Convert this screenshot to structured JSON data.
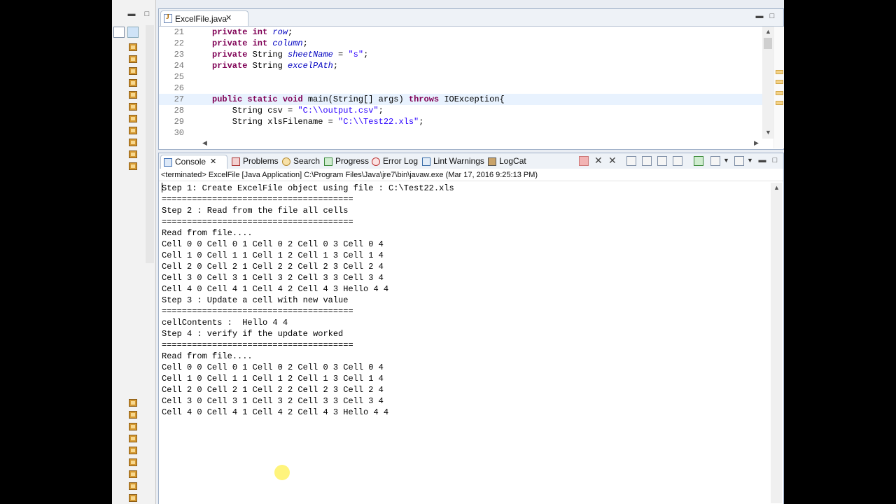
{
  "editor": {
    "tab_label": "ExcelFile.java",
    "lines": [
      {
        "num": "21",
        "parts": [
          [
            "kw",
            "private "
          ],
          [
            "kw",
            "int "
          ],
          [
            "fld",
            "row"
          ],
          [
            "var",
            ";"
          ]
        ]
      },
      {
        "num": "22",
        "parts": [
          [
            "kw",
            "private "
          ],
          [
            "kw",
            "int "
          ],
          [
            "fld",
            "column"
          ],
          [
            "var",
            ";"
          ]
        ]
      },
      {
        "num": "23",
        "parts": [
          [
            "kw",
            "private "
          ],
          [
            "var",
            "String "
          ],
          [
            "fld",
            "sheetName"
          ],
          [
            "var",
            " = "
          ],
          [
            "str",
            "\"s\""
          ],
          [
            "var",
            ";"
          ]
        ]
      },
      {
        "num": "24",
        "parts": [
          [
            "kw",
            "private "
          ],
          [
            "var",
            "String "
          ],
          [
            "fld",
            "excelPAth"
          ],
          [
            "var",
            ";"
          ]
        ]
      },
      {
        "num": "25",
        "parts": []
      },
      {
        "num": "26",
        "parts": []
      },
      {
        "num": "27",
        "parts": [
          [
            "kw",
            "public "
          ],
          [
            "kw",
            "static "
          ],
          [
            "kw",
            "void "
          ],
          [
            "var",
            "main(String[] args) "
          ],
          [
            "kw",
            "throws "
          ],
          [
            "var",
            "IOException{"
          ]
        ]
      },
      {
        "num": "28",
        "parts": [
          [
            "var",
            "    String csv = "
          ],
          [
            "str",
            "\"C:\\\\output.csv\""
          ],
          [
            "var",
            ";"
          ]
        ]
      },
      {
        "num": "29",
        "parts": [
          [
            "var",
            "    String xlsFilename = "
          ],
          [
            "str",
            "\"C:\\\\Test22.xls\""
          ],
          [
            "var",
            ";"
          ]
        ]
      },
      {
        "num": "30",
        "parts": []
      }
    ]
  },
  "console": {
    "tabs": [
      "Console",
      "Problems",
      "Search",
      "Progress",
      "Error Log",
      "Lint Warnings",
      "LogCat"
    ],
    "status": "<terminated> ExcelFile [Java Application] C:\\Program Files\\Java\\jre7\\bin\\javaw.exe (Mar 17, 2016 9:25:13 PM)",
    "output": [
      "Step 1: Create ExcelFile object using file : C:\\Test22.xls",
      "======================================",
      "Step 2 : Read from the file all cells",
      "======================================",
      "Read from file....",
      "Cell 0 0 Cell 0 1 Cell 0 2 Cell 0 3 Cell 0 4",
      "Cell 1 0 Cell 1 1 Cell 1 2 Cell 1 3 Cell 1 4",
      "Cell 2 0 Cell 2 1 Cell 2 2 Cell 2 3 Cell 2 4",
      "Cell 3 0 Cell 3 1 Cell 3 2 Cell 3 3 Cell 3 4",
      "Cell 4 0 Cell 4 1 Cell 4 2 Cell 4 3 Hello 4 4",
      "Step 3 : Update a cell with new value",
      "======================================",
      "cellContents :  Hello 4 4",
      "Step 4 : verify if the update worked",
      "======================================",
      "Read from file....",
      "Cell 0 0 Cell 0 1 Cell 0 2 Cell 0 3 Cell 0 4",
      "Cell 1 0 Cell 1 1 Cell 1 2 Cell 1 3 Cell 1 4",
      "Cell 2 0 Cell 2 1 Cell 2 2 Cell 2 3 Cell 2 4",
      "Cell 3 0 Cell 3 1 Cell 3 2 Cell 3 3 Cell 3 4",
      "Cell 4 0 Cell 4 1 Cell 4 2 Cell 4 3 Hello 4 4"
    ]
  },
  "icons": {
    "tab_close": "close-icon",
    "minimize": "minimize-icon",
    "maximize": "maximize-icon"
  },
  "colors": {
    "keyword": "#7f0055",
    "string": "#2a00ff",
    "field": "#0000c0",
    "current_line": "#e8f2fe"
  }
}
